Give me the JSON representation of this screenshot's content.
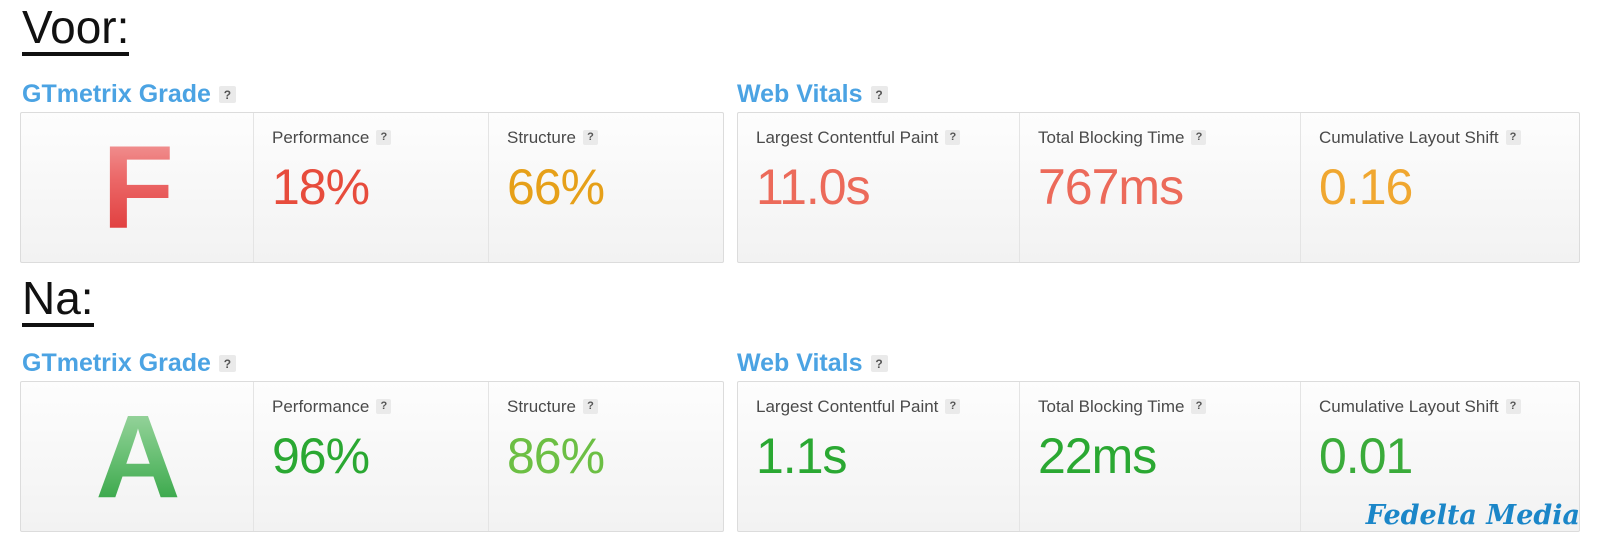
{
  "sections": [
    {
      "heading": "Voor:",
      "grade_panel": {
        "title": "GTmetrix Grade",
        "help": "?",
        "grade": "F",
        "grade_color": "#dd3131",
        "metrics": [
          {
            "label": "Performance",
            "help": "?",
            "value": "18%",
            "color": "#e74c3c"
          },
          {
            "label": "Structure",
            "help": "?",
            "value": "66%",
            "color": "#e6a019"
          }
        ]
      },
      "vitals_panel": {
        "title": "Web Vitals",
        "help": "?",
        "metrics": [
          {
            "label": "Largest Contentful Paint",
            "help": "?",
            "value": "11.0s",
            "color": "#ec6a5a"
          },
          {
            "label": "Total Blocking Time",
            "help": "?",
            "value": "767ms",
            "color": "#ec6a5a"
          },
          {
            "label": "Cumulative Layout Shift",
            "help": "?",
            "value": "0.16",
            "color": "#f0a730"
          }
        ]
      }
    },
    {
      "heading": "Na:",
      "grade_panel": {
        "title": "GTmetrix Grade",
        "help": "?",
        "grade": "A",
        "grade_color": "#2ba03d",
        "metrics": [
          {
            "label": "Performance",
            "help": "?",
            "value": "96%",
            "color": "#2aa832"
          },
          {
            "label": "Structure",
            "help": "?",
            "value": "86%",
            "color": "#6cbf44"
          }
        ]
      },
      "vitals_panel": {
        "title": "Web Vitals",
        "help": "?",
        "metrics": [
          {
            "label": "Largest Contentful Paint",
            "help": "?",
            "value": "1.1s",
            "color": "#2aa832"
          },
          {
            "label": "Total Blocking Time",
            "help": "?",
            "value": "22ms",
            "color": "#2aa832"
          },
          {
            "label": "Cumulative Layout Shift",
            "help": "?",
            "value": "0.01",
            "color": "#3aab3a"
          }
        ]
      }
    }
  ],
  "watermark": {
    "text": "Fedelta Media",
    "color": "#1b86c8"
  },
  "theme": {
    "panel_title_color": "#4ba3e3",
    "card_border_color": "#dcdcdc",
    "label_color": "#4a4a4a",
    "heading_color": "#111111"
  }
}
